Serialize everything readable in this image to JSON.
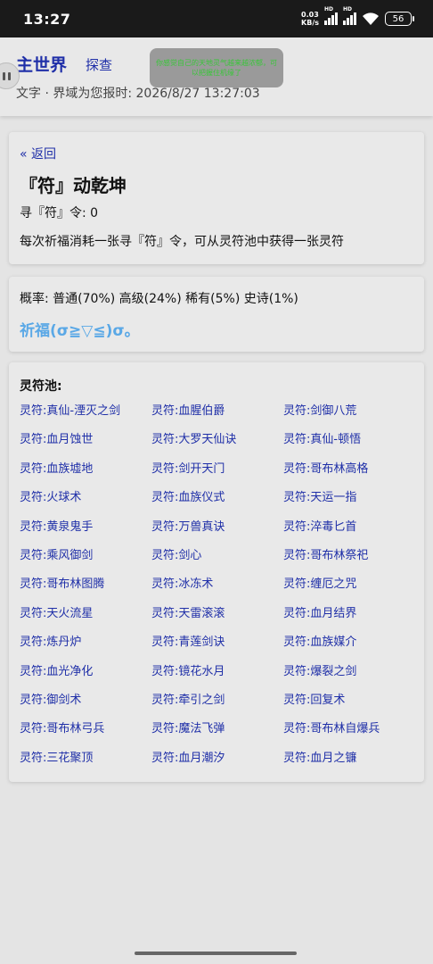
{
  "status": {
    "time": "13:27",
    "net_speed_value": "0.03",
    "net_speed_unit": "KB/s",
    "sig_label": "HD",
    "battery": "56"
  },
  "header": {
    "main_world": "主世界",
    "explore": "探查",
    "report": "文字 · 界域为您报时: 2026/8/27 13:27:03",
    "toast": "你感觉自己的天地灵气越来越浓郁，可以把握住机缘了"
  },
  "talisman": {
    "back": "« 返回",
    "title": "『符』动乾坤",
    "tokens": "寻『符』令: 0",
    "description": "每次祈福消耗一张寻『符』令，可从灵符池中获得一张灵符"
  },
  "gacha": {
    "rates": "概率: 普通(70%) 高级(24%) 稀有(5%) 史诗(1%)",
    "pray_button": "祈福(σ≧▽≦)σ。"
  },
  "pool": {
    "title": "灵符池:",
    "items": [
      "灵符:真仙-湮灭之剑",
      "灵符:血腥伯爵",
      "灵符:剑御八荒",
      "灵符:血月蚀世",
      "灵符:大罗天仙诀",
      "灵符:真仙-顿悟",
      "灵符:血族墟地",
      "灵符:剑开天门",
      "灵符:哥布林高格",
      "灵符:火球术",
      "灵符:血族仪式",
      "灵符:天运一指",
      "灵符:黄泉鬼手",
      "灵符:万兽真诀",
      "灵符:淬毒匕首",
      "灵符:乘风御剑",
      "灵符:剑心",
      "灵符:哥布林祭祀",
      "灵符:哥布林图腾",
      "灵符:冰冻术",
      "灵符:缠厄之咒",
      "灵符:天火流星",
      "灵符:天雷滚滚",
      "灵符:血月结界",
      "灵符:炼丹炉",
      "灵符:青莲剑诀",
      "灵符:血族媒介",
      "灵符:血光净化",
      "灵符:镜花水月",
      "灵符:爆裂之剑",
      "灵符:御剑术",
      "灵符:牵引之剑",
      "灵符:回复术",
      "灵符:哥布林弓兵",
      "灵符:魔法飞弹",
      "灵符:哥布林自爆兵",
      "灵符:三花聚顶",
      "灵符:血月潮汐",
      "灵符:血月之镰"
    ]
  },
  "colors": {
    "link": "#1f2fa8",
    "pray": "#5aa8e6",
    "toast_text": "#39c639"
  }
}
